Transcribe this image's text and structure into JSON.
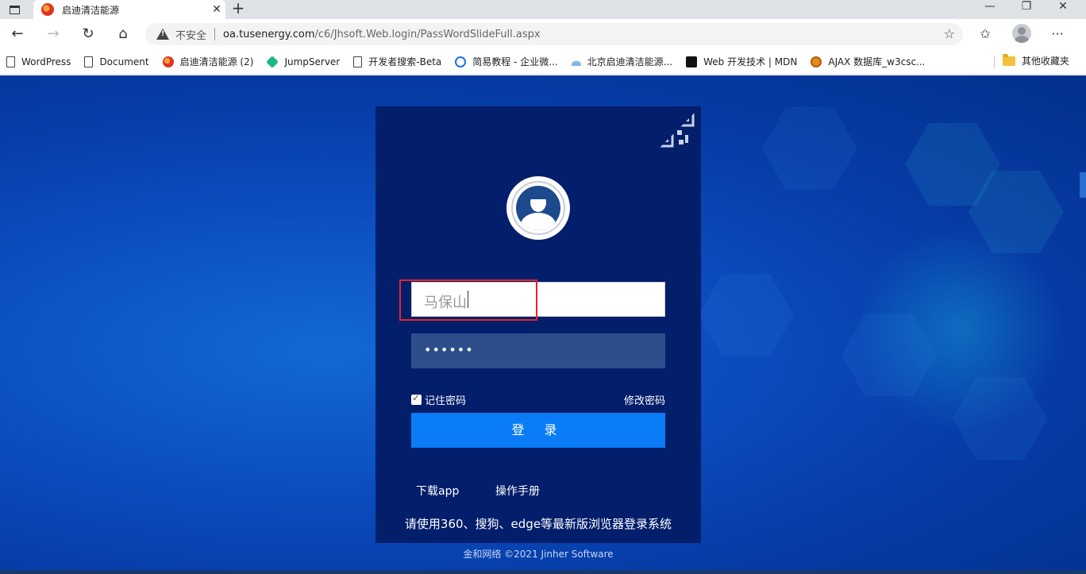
{
  "browser": {
    "tab": {
      "title": "启迪清洁能源",
      "close": "✕"
    },
    "new_tab": "+",
    "window": {
      "minimize": "—",
      "restore": "❐",
      "close": "✕"
    },
    "nav": {
      "back": "←",
      "forward": "→",
      "refresh": "↻",
      "home": "⌂"
    },
    "address": {
      "security_label": "不安全",
      "domain": "oa.tusenergy.com",
      "path": "/c6/Jhsoft.Web.login/PassWordSlideFull.aspx"
    },
    "toolbar": {
      "favorites": "☆",
      "collections": "✩",
      "menu": "···"
    },
    "bookmarks": [
      {
        "label": "WordPress",
        "icon": "document-icon"
      },
      {
        "label": "Document",
        "icon": "document-icon"
      },
      {
        "label": "启迪清洁能源 (2)",
        "icon": "site-icon"
      },
      {
        "label": "JumpServer",
        "icon": "jumpserver-icon"
      },
      {
        "label": "开发者搜索-Beta",
        "icon": "document-icon"
      },
      {
        "label": "简易教程 - 企业微...",
        "icon": "wecom-icon"
      },
      {
        "label": "北京启迪清洁能源...",
        "icon": "cloud-icon"
      },
      {
        "label": "Web 开发技术 | MDN",
        "icon": "mdn-icon"
      },
      {
        "label": "AJAX 数据库_w3csc...",
        "icon": "w3c-icon"
      }
    ],
    "other_bookmarks": "其他收藏夹"
  },
  "login": {
    "username": "马保山",
    "password_mask": "••••••",
    "remember_label": "记住密码",
    "remember_checked": true,
    "change_password": "修改密码",
    "submit": "登 录",
    "download_app": "下载app",
    "manual": "操作手册",
    "notice": "请使用360、搜狗、edge等最新版浏览器登录系统"
  },
  "footer": "金和网络 ©2021 Jinher Software",
  "colors": {
    "card": "#031e6b",
    "button": "#0a7cf6",
    "highlight": "#e3262a",
    "background": "#0b4ec0"
  }
}
